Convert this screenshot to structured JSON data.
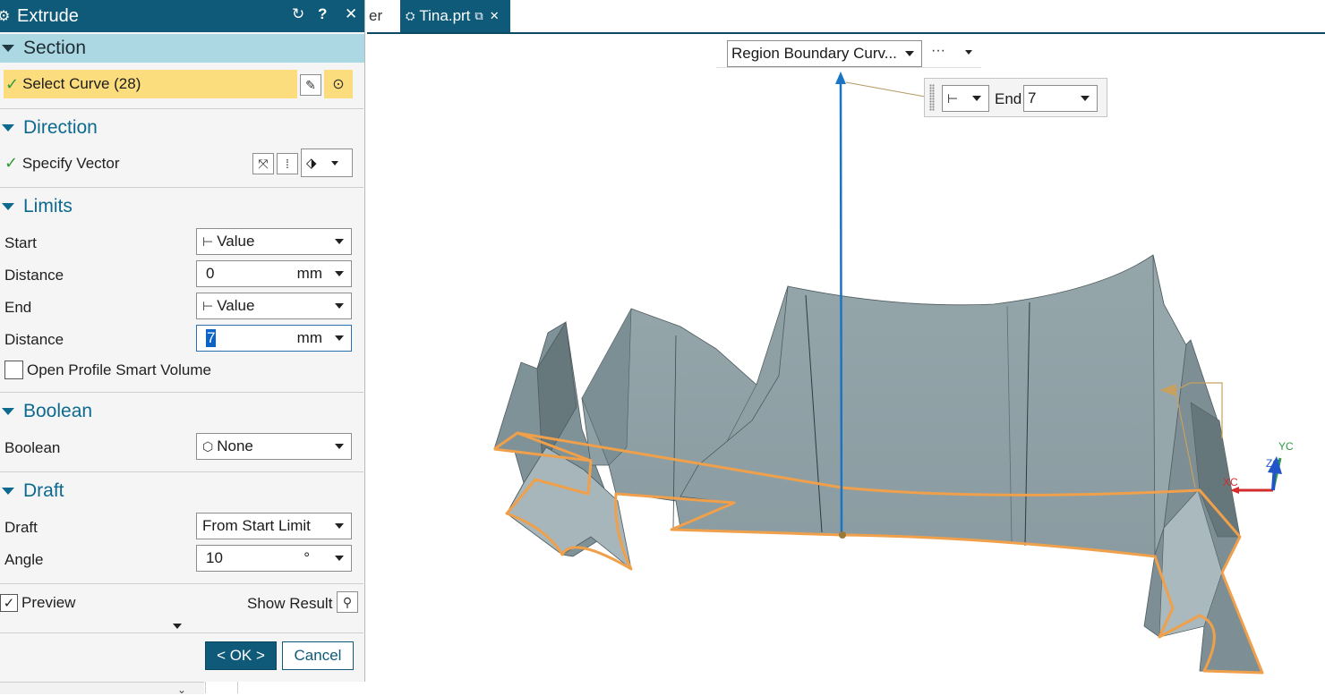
{
  "tabs": {
    "partial_label": "er",
    "active_label": "Tina.prt"
  },
  "dialog": {
    "title": "Extrude",
    "section": {
      "header": "Section",
      "select_curve_label": "Select Curve (28)"
    },
    "direction": {
      "header": "Direction",
      "specify_vector_label": "Specify Vector"
    },
    "limits": {
      "header": "Limits",
      "start_label": "Start",
      "start_value": "Value",
      "start_distance_label": "Distance",
      "start_distance_value": "0",
      "start_distance_unit": "mm",
      "end_label": "End",
      "end_value": "Value",
      "end_distance_label": "Distance",
      "end_distance_value": "7",
      "end_distance_unit": "mm",
      "open_profile_label": "Open Profile Smart Volume"
    },
    "boolean": {
      "header": "Boolean",
      "label": "Boolean",
      "value": "None"
    },
    "draft": {
      "header": "Draft",
      "draft_label": "Draft",
      "draft_value": "From Start Limit",
      "angle_label": "Angle",
      "angle_value": "10",
      "angle_unit": "°"
    },
    "footer": {
      "preview_label": "Preview",
      "show_result_label": "Show Result",
      "ok_label": "< OK >",
      "cancel_label": "Cancel"
    }
  },
  "viewport": {
    "selection_filter": "Region Boundary Curv...",
    "more_label": "···",
    "handle_end_label": "End",
    "handle_end_value": "7",
    "triad": {
      "x_label": "XC",
      "y_label": "YC",
      "z_label": "ZC"
    }
  },
  "colors": {
    "title_bar": "#0e5a78",
    "section_blue": "#acd8e3",
    "select_highlight": "#fbdd7e",
    "surface": "#8d9ea3",
    "curve_orange": "#f0a04b",
    "vector_blue": "#1a74c4"
  }
}
